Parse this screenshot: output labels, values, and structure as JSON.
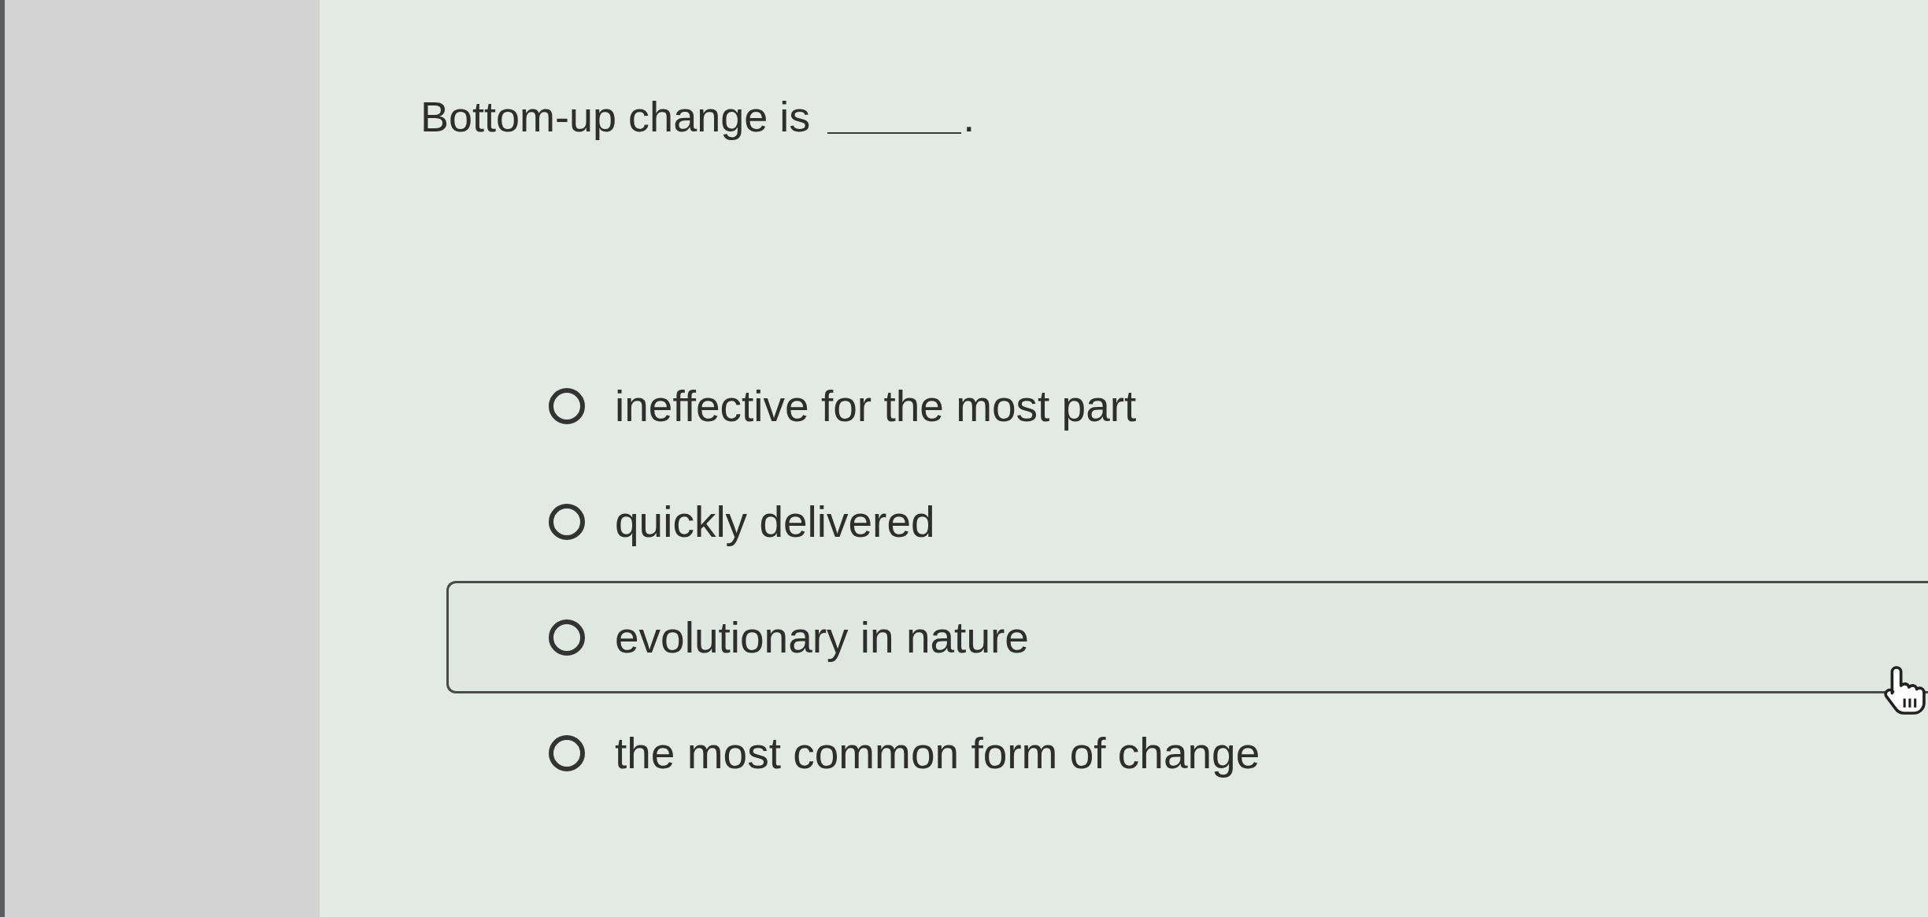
{
  "question": {
    "text": "Bottom-up change is",
    "answer_blank": true,
    "end": "."
  },
  "options": [
    {
      "label": "ineffective for the most part",
      "selected": false,
      "hovered": false
    },
    {
      "label": "quickly delivered",
      "selected": false,
      "hovered": false
    },
    {
      "label": "evolutionary in nature",
      "selected": false,
      "hovered": true
    },
    {
      "label": "the most common form of change",
      "selected": false,
      "hovered": false
    }
  ],
  "cursor": {
    "kind": "hand"
  }
}
